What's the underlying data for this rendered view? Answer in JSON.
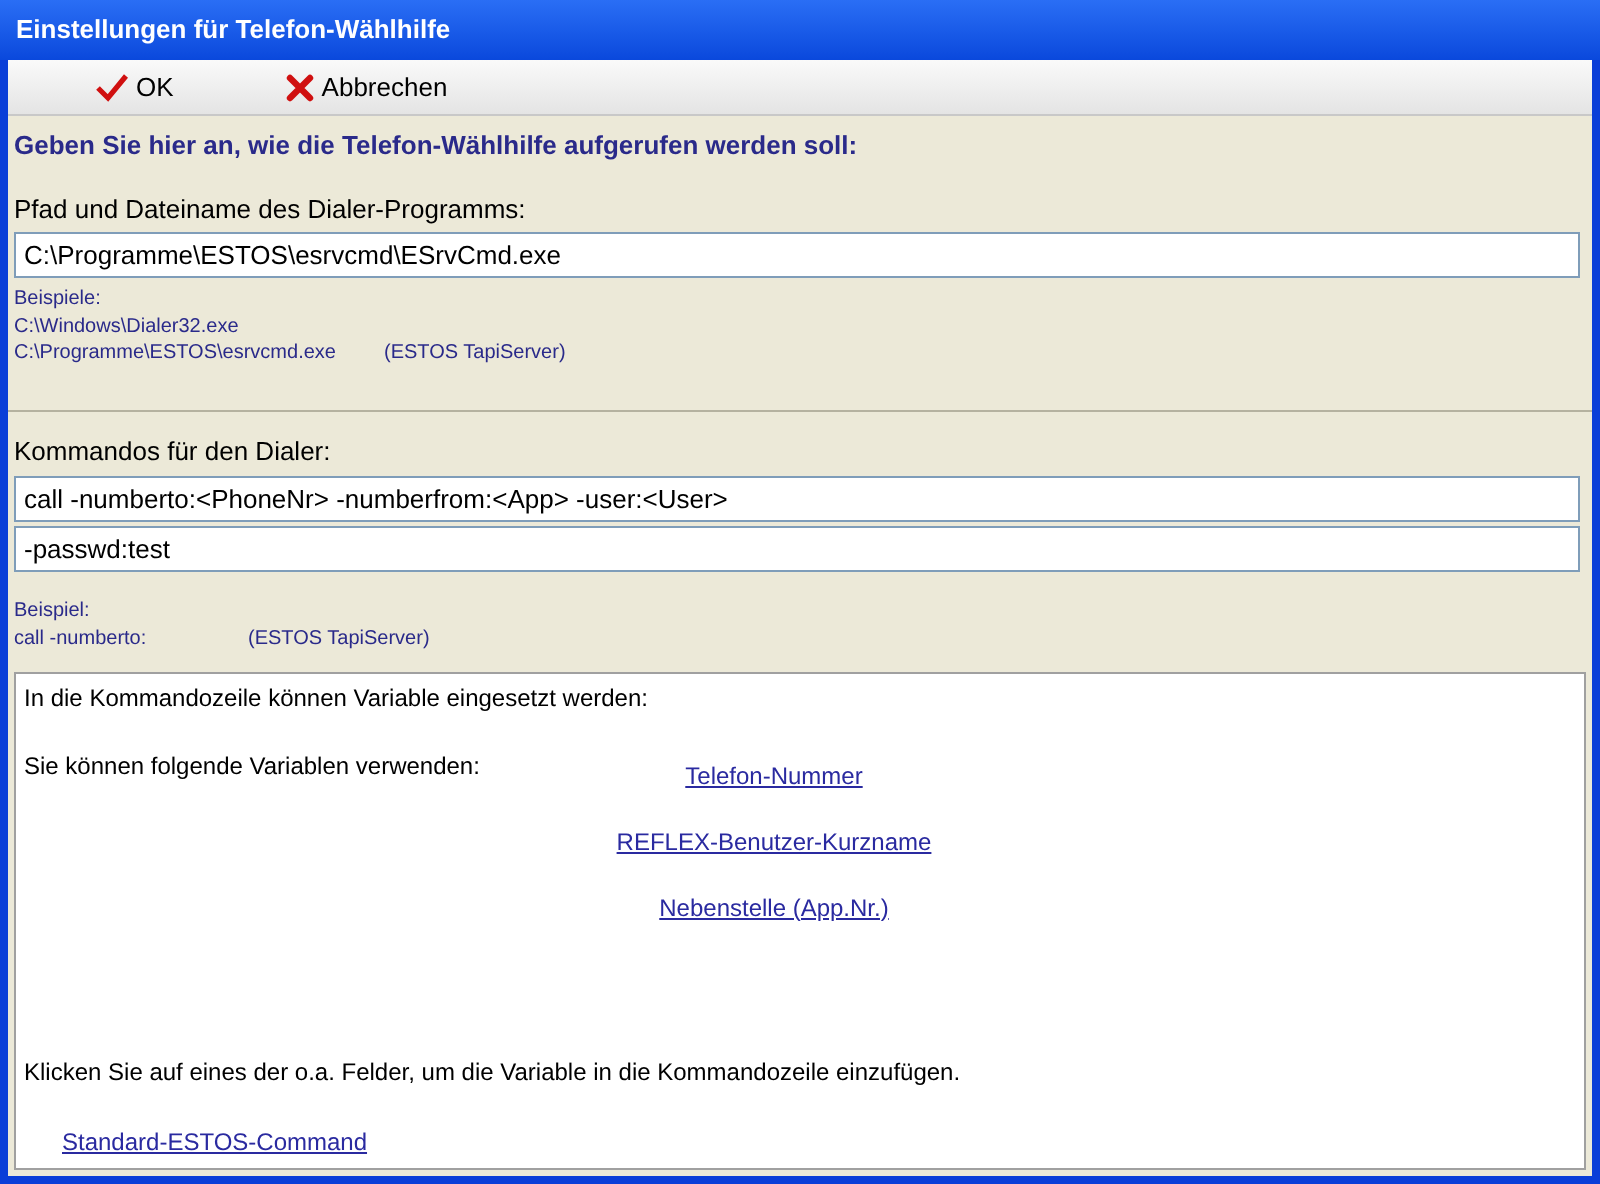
{
  "window": {
    "title": "Einstellungen für Telefon-Wählhilfe"
  },
  "toolbar": [
    {
      "kind": "ok",
      "label": "OK"
    },
    {
      "kind": "cancel",
      "label": "Abbrechen"
    }
  ],
  "heading": "Geben Sie hier an, wie die Telefon-Wählhilfe aufgerufen werden soll:",
  "dialer_path": {
    "label": "Pfad und Dateiname des Dialer-Programms:",
    "value": "C:\\Programme\\ESTOS\\esrvcmd\\ESrvCmd.exe",
    "examples_title": "Beispiele:",
    "examples": [
      {
        "path": "C:\\Windows\\Dialer32.exe"
      },
      {
        "path": "C:\\Programme\\ESTOS\\esrvcmd.exe",
        "note": "(ESTOS TapiServer)"
      }
    ]
  },
  "commands": {
    "label": "Kommandos für den Dialer:",
    "lines": [
      "call -numberto:<PhoneNr> -numberfrom:<App> -user:<User>",
      "-passwd:test"
    ],
    "example_title": "Beispiel:",
    "example": {
      "command": "call -numberto:",
      "note": "(ESTOS TapiServer)"
    }
  },
  "help": {
    "intro": "In die Kommandozeile können Variable eingesetzt werden:",
    "variables_label": "Sie können folgende Variablen verwenden:",
    "variables": [
      "Telefon-Nummer",
      "REFLEX-Benutzer-Kurzname",
      "Nebenstelle (App.Nr.)"
    ],
    "hint": "Klicken Sie auf eines der o.a. Felder, um die Variable in die Kommandozeile einzufügen.",
    "standard_link": "Standard-ESTOS-Command"
  }
}
